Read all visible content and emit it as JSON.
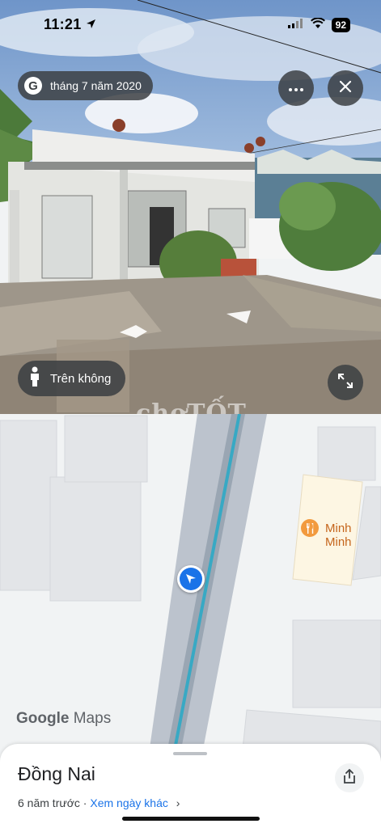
{
  "status_bar": {
    "time": "11:21",
    "battery": "92"
  },
  "street_view": {
    "date_badge_letter": "G",
    "date_label": "tháng 7 năm 2020",
    "aerial_label": "Trên không",
    "watermark": "chợTỐT"
  },
  "map": {
    "poi_name": "Minh Minh",
    "google_word": "Google",
    "maps_word": "Maps"
  },
  "sheet": {
    "title": "Đồng Nai",
    "age": "6 năm trước",
    "separator": " · ",
    "other_dates_link": "Xem ngày khác",
    "chevron": "›"
  },
  "colors": {
    "accent": "#1a73e8",
    "road_line": "#38a9c4",
    "poi": "#f29a3e"
  },
  "icons": [
    "location-arrow-icon",
    "signal-icon",
    "wifi-icon",
    "battery-icon",
    "google-g-icon",
    "more-icon",
    "close-icon",
    "pegman-icon",
    "expand-icon",
    "restaurant-icon",
    "navigation-arrow-icon",
    "share-icon",
    "chevron-right-icon"
  ]
}
